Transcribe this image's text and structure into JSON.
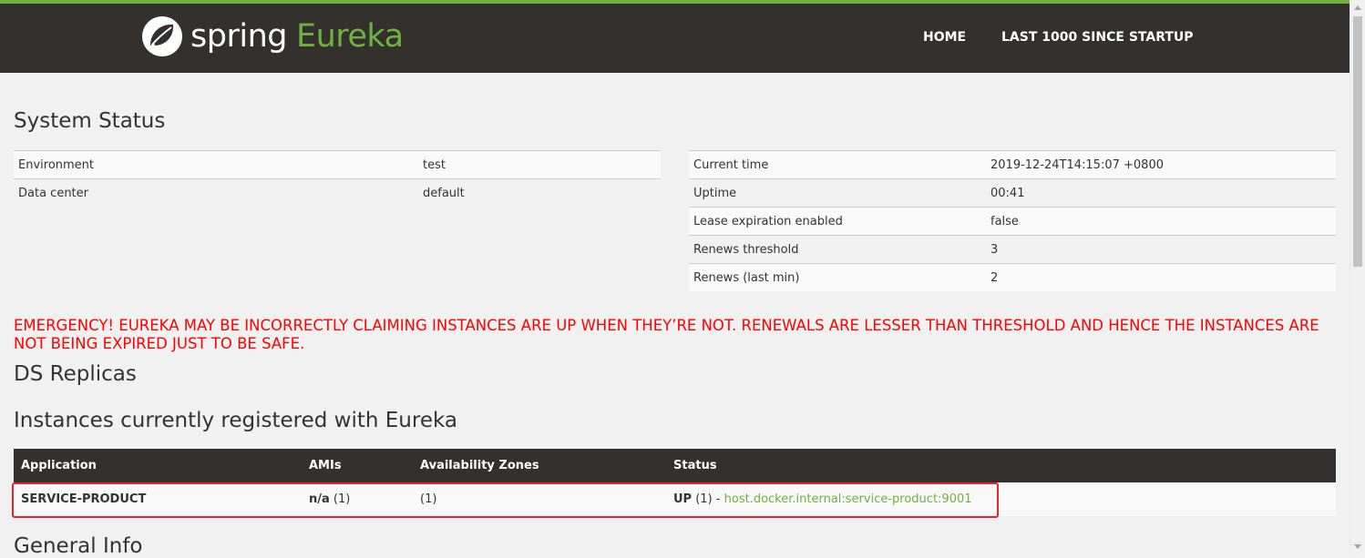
{
  "header": {
    "logo_word": "spring",
    "logo_product": "Eureka",
    "nav": [
      "HOME",
      "LAST 1000 SINCE STARTUP"
    ],
    "colors": {
      "bar": "#34302d",
      "accent": "#6db33f"
    }
  },
  "system_status": {
    "title": "System Status",
    "left": [
      {
        "label": "Environment",
        "value": "test"
      },
      {
        "label": "Data center",
        "value": "default"
      }
    ],
    "right": [
      {
        "label": "Current time",
        "value": "2019-12-24T14:15:07 +0800"
      },
      {
        "label": "Uptime",
        "value": "00:41"
      },
      {
        "label": "Lease expiration enabled",
        "value": "false"
      },
      {
        "label": "Renews threshold",
        "value": "3"
      },
      {
        "label": "Renews (last min)",
        "value": "2"
      }
    ]
  },
  "emergency": "EMERGENCY! EUREKA MAY BE INCORRECTLY CLAIMING INSTANCES ARE UP WHEN THEY’RE NOT. RENEWALS ARE LESSER THAN THRESHOLD AND HENCE THE INSTANCES ARE NOT BEING EXPIRED JUST TO BE SAFE.",
  "ds_replicas": {
    "title": "DS Replicas"
  },
  "instances": {
    "title": "Instances currently registered with Eureka",
    "columns": [
      "Application",
      "AMIs",
      "Availability Zones",
      "Status"
    ],
    "rows": [
      {
        "application": "SERVICE-PRODUCT",
        "amis_label": "n/a",
        "amis_count": "(1)",
        "zones": "(1)",
        "status": "UP",
        "status_count": "(1) -",
        "instance_link": "host.docker.internal:service-product:9001"
      }
    ]
  },
  "general_info": {
    "title": "General Info"
  }
}
